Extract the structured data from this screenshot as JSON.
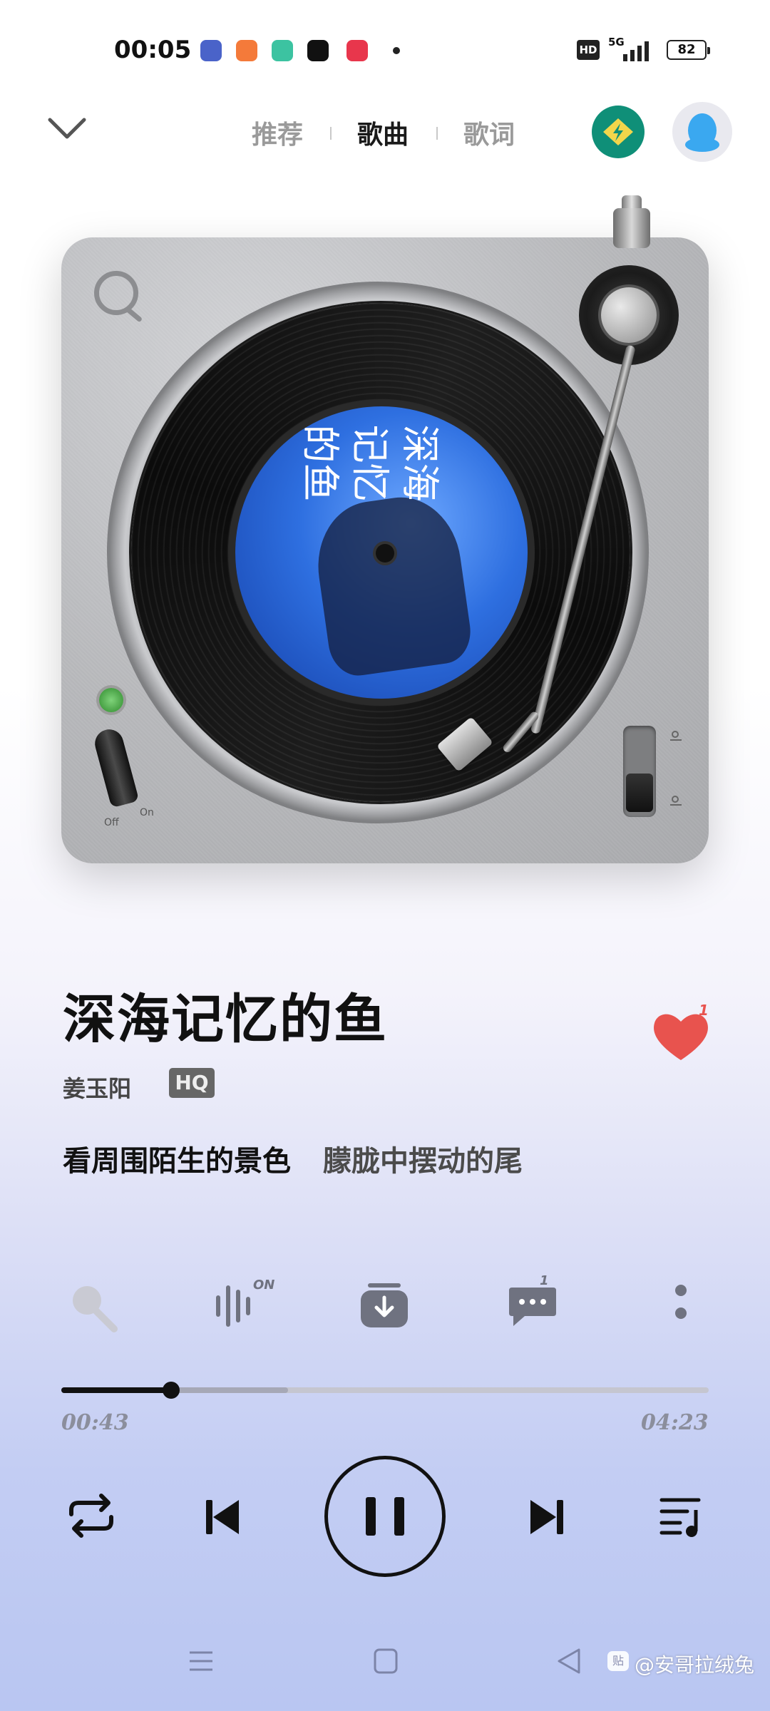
{
  "status_bar": {
    "time": "00:05",
    "app_icons": [
      "tieba-icon",
      "books-icon",
      "soul-icon",
      "douyin-icon",
      "video-icon"
    ],
    "hd": "HD",
    "network": "5G",
    "battery": "82"
  },
  "header": {
    "tabs": [
      "推荐",
      "歌曲",
      "歌词"
    ],
    "active_tab": "歌曲"
  },
  "song": {
    "title": "深海记忆的鱼",
    "artist": "姜玉阳",
    "quality": "HQ",
    "like_count": "1",
    "lyric_sung": "看周围陌生的景色",
    "lyric_upcoming": "朦胧中摆动的尾"
  },
  "record_label": {
    "line1": "深海",
    "line2": "记忆",
    "line3": "的鱼"
  },
  "turntable": {
    "off": "Off",
    "on": "On"
  },
  "toolbar": {
    "effect_badge": "ON",
    "comment_count": "1"
  },
  "progress": {
    "current": "00:43",
    "total": "04:23",
    "fraction": 0.17,
    "buffered_fraction": 0.35
  },
  "watermark": {
    "text": "@安哥拉绒兔",
    "icon_text": "贴"
  },
  "colors": {
    "accent_green": "#0f8f78",
    "heart": "#e8534e",
    "avatar_bg": "#3aa8f0"
  }
}
